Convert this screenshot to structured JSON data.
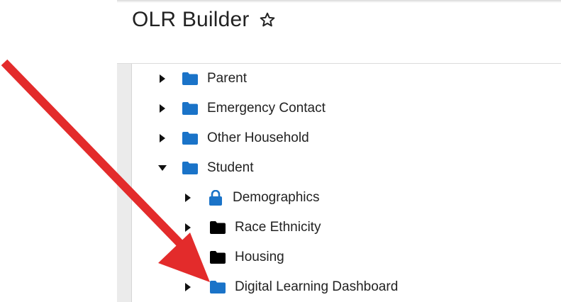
{
  "header": {
    "title": "OLR Builder",
    "star_icon": "star-outline-icon"
  },
  "colors": {
    "folder_blue": "#1a73c8",
    "folder_black": "#000000",
    "arrow_red": "#e32b2b"
  },
  "tree": {
    "items": [
      {
        "label": "Parent",
        "expanded": false,
        "icon": "folder-icon",
        "color": "blue"
      },
      {
        "label": "Emergency Contact",
        "expanded": false,
        "icon": "folder-icon",
        "color": "blue"
      },
      {
        "label": "Other Household",
        "expanded": false,
        "icon": "folder-icon",
        "color": "blue"
      },
      {
        "label": "Student",
        "expanded": true,
        "icon": "folder-icon",
        "color": "blue",
        "children": [
          {
            "label": "Demographics",
            "expanded": false,
            "icon": "lock-icon",
            "color": "blue"
          },
          {
            "label": "Race Ethnicity",
            "expanded": false,
            "icon": "folder-icon",
            "color": "black"
          },
          {
            "label": "Housing",
            "expanded": false,
            "icon": "folder-icon",
            "color": "black"
          },
          {
            "label": "Digital Learning Dashboard",
            "expanded": false,
            "icon": "folder-icon",
            "color": "blue"
          }
        ]
      }
    ]
  }
}
